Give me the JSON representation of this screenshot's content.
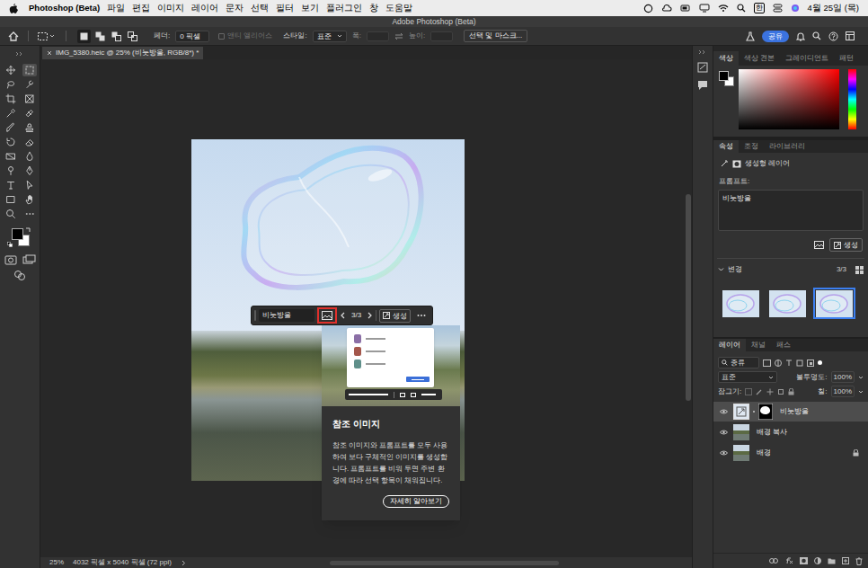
{
  "menubar": {
    "app": "Photoshop (Beta)",
    "menus": [
      "파일",
      "편집",
      "이미지",
      "레이어",
      "문자",
      "선택",
      "필터",
      "보기",
      "플러그인",
      "창",
      "도움말"
    ],
    "input_source": "한",
    "clock": "4월 25일 (목)"
  },
  "window": {
    "title": "Adobe Photoshop (Beta)"
  },
  "options_bar": {
    "selection_modes": [
      {
        "selected": true
      },
      {
        "selected": false
      },
      {
        "selected": false
      },
      {
        "selected": false
      }
    ],
    "feather_label": "페더:",
    "feather_value": "0 픽셀",
    "antialias": {
      "label": "앤티 앨리어스",
      "disabled": true
    },
    "style_label": "스타일:",
    "style_value": "표준",
    "width_label": "폭:",
    "height_label": "높이:",
    "select_and_mask": "선택 및 마스크...",
    "share": "공유"
  },
  "tools": [
    {
      "selected": false
    },
    {
      "selected": true
    },
    {
      "selected": false
    },
    {
      "selected": false
    },
    {
      "selected": false
    },
    {
      "selected": false
    },
    {
      "selected": false
    },
    {
      "selected": false
    },
    {
      "selected": false
    },
    {
      "selected": false
    },
    {
      "selected": false
    },
    {
      "selected": false
    },
    {
      "selected": false
    },
    {
      "selected": false
    },
    {
      "selected": false
    },
    {
      "selected": false
    },
    {
      "selected": false
    },
    {
      "selected": false
    },
    {
      "selected": false
    },
    {
      "selected": false
    },
    {
      "selected": false
    },
    {
      "selected": false
    }
  ],
  "document_tab": {
    "title": "IMG_5380.heic @ 25% (비눗방울, RGB/8*) *"
  },
  "taskbar": {
    "prompt": "비눗방울",
    "reference_image_highlighted": true,
    "variation": "3/3",
    "generate": "생성"
  },
  "popover": {
    "illustration_rows": [
      {
        "color": "#8b6fa6"
      },
      {
        "color": "#a4574c"
      },
      {
        "color": "#5f8f8a"
      }
    ],
    "title": "참조 이미지",
    "body": "참조 이미지와 프롬프트를 모두 사용하여 보다 구체적인 이미지를 생성합니다. 프롬프트를 비워 두면 주변 환경에 따라 선택 항목이 채워집니다.",
    "button": "자세히 알아보기"
  },
  "status_bar": {
    "zoom": "25%",
    "info": "4032 픽셀 x 5040 픽셀 (72 ppi)"
  },
  "color_panel": {
    "tabs": [
      {
        "label": "색상",
        "selected": true
      },
      {
        "label": "색상 견본",
        "selected": false
      },
      {
        "label": "그레이디언트",
        "selected": false
      },
      {
        "label": "패턴",
        "selected": false
      }
    ]
  },
  "properties_panel": {
    "tabs": [
      {
        "label": "속성",
        "selected": true
      },
      {
        "label": "조정",
        "selected": false
      },
      {
        "label": "라이브러리",
        "selected": false
      }
    ],
    "layer_kind": "생성형 레이어",
    "prompt_label": "프롬프트:",
    "prompt": "비눗방울",
    "generate": "생성",
    "variations_label": "변경",
    "variations_count": "3/3",
    "variations": [
      {
        "selected": false
      },
      {
        "selected": false
      },
      {
        "selected": true
      }
    ]
  },
  "layers_panel": {
    "tabs": [
      {
        "label": "레이어",
        "selected": true
      },
      {
        "label": "채널",
        "selected": false
      },
      {
        "label": "패스",
        "selected": false
      }
    ],
    "filter": "종류",
    "blend_mode": "표준",
    "opacity_label": "불투명도:",
    "opacity": "100%",
    "lock_label": "잠그기:",
    "fill_label": "칠:",
    "fill": "100%",
    "layers": [
      {
        "name": "비눗방울",
        "kind": "generative",
        "selected": true,
        "visible": true,
        "locked": false
      },
      {
        "name": "배경 복사",
        "kind": "image",
        "selected": false,
        "visible": true,
        "locked": false
      },
      {
        "name": "배경",
        "kind": "image",
        "selected": false,
        "visible": true,
        "locked": true
      }
    ]
  }
}
